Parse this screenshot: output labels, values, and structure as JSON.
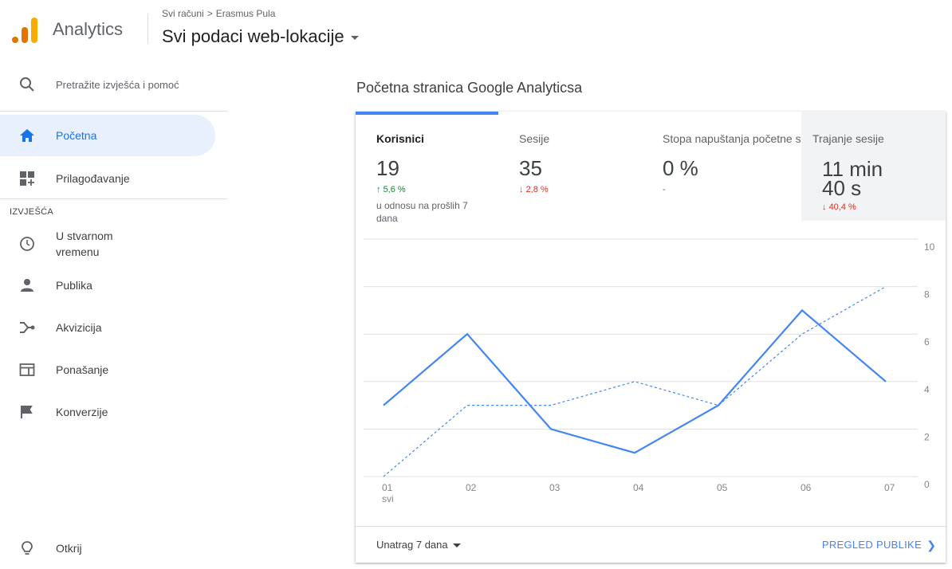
{
  "app": {
    "name": "Analytics"
  },
  "header": {
    "breadcrumb": [
      "Svi računi",
      "Erasmus Pula"
    ],
    "breadcrumb_sep": ">",
    "property": "Svi podaci web-lokacije"
  },
  "sidebar": {
    "search_placeholder": "Pretražite izvješća i pomoć",
    "items": [
      {
        "label": "Početna",
        "icon": "home-icon",
        "active": true
      },
      {
        "label": "Prilagođavanje",
        "icon": "dashboard-add-icon"
      }
    ],
    "section_label": "IZVJEŠĆA",
    "reports": [
      {
        "label": "U stvarnom vremenu",
        "icon": "clock-icon"
      },
      {
        "label": "Publika",
        "icon": "person-icon"
      },
      {
        "label": "Akvizicija",
        "icon": "acquisition-icon"
      },
      {
        "label": "Ponašanje",
        "icon": "behavior-icon"
      },
      {
        "label": "Konverzije",
        "icon": "flag-icon"
      }
    ],
    "discover": {
      "label": "Otkrij",
      "icon": "lightbulb-icon"
    }
  },
  "main": {
    "title": "Početna stranica Google Analyticsa",
    "metrics": [
      {
        "label": "Korisnici",
        "value": "19",
        "change": "5,6 %",
        "direction": "up",
        "compare": "u odnosu na prošlih 7 dana"
      },
      {
        "label": "Sesije",
        "value": "35",
        "change": "2,8 %",
        "direction": "down"
      },
      {
        "label": "Stopa napuštanja početne stranice",
        "value": "0 %",
        "change": "-"
      },
      {
        "label": "Trajanje sesije",
        "value": "11 min 40 s",
        "change": "40,4 %",
        "direction": "down"
      }
    ],
    "footer": {
      "range": "Unatrag 7 dana",
      "link": "PREGLED PUBLIKE"
    }
  },
  "colors": {
    "accent": "#4285f4",
    "up": "#188038",
    "down": "#d93025"
  },
  "chart_data": {
    "type": "line",
    "x": [
      "01",
      "02",
      "03",
      "04",
      "05",
      "06",
      "07"
    ],
    "x_sublabel": "svi",
    "series": [
      {
        "values": [
          3,
          6,
          2,
          1,
          3,
          7,
          4
        ],
        "style": "solid"
      },
      {
        "values": [
          0,
          3,
          3,
          4,
          3,
          6,
          8
        ],
        "style": "dashed"
      }
    ],
    "yticks": [
      0,
      2,
      4,
      6,
      8,
      10
    ],
    "ylim": [
      0,
      10
    ],
    "grid": true
  }
}
